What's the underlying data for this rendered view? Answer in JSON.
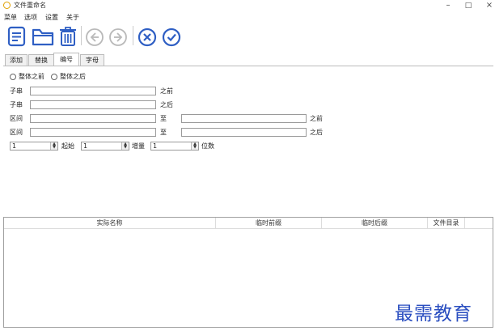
{
  "window": {
    "title": "文件重命名",
    "minimize": "–",
    "maximize": "□",
    "close": "×"
  },
  "menu": [
    "菜单",
    "选项",
    "设置",
    "关于"
  ],
  "toolbar": {
    "icons": [
      "document-icon",
      "folder-icon",
      "trash-icon",
      "undo-icon",
      "redo-icon",
      "cancel-icon",
      "confirm-icon"
    ],
    "accent": "#2f5fc4"
  },
  "tabs": [
    {
      "label": "添加"
    },
    {
      "label": "替换"
    },
    {
      "label": "编号"
    },
    {
      "label": "字母"
    }
  ],
  "numbering": {
    "radio_before": "整体之前",
    "radio_after": "整体之后",
    "row1": {
      "label": "子串",
      "suffix": "之前",
      "value": ""
    },
    "row2": {
      "label": "子串",
      "suffix": "之后",
      "value": ""
    },
    "row3": {
      "label": "区间",
      "mid": "至",
      "suffix": "之前",
      "from": "",
      "to": ""
    },
    "row4": {
      "label": "区间",
      "mid": "至",
      "suffix": "之后",
      "from": "",
      "to": ""
    },
    "start": {
      "value": "1",
      "label": "起始"
    },
    "step": {
      "value": "1",
      "label": "增量"
    },
    "digits": {
      "value": "1",
      "label": "位数"
    }
  },
  "table": {
    "columns": [
      "实际名称",
      "临时前缀",
      "临时后缀",
      "文件目录"
    ]
  },
  "watermark": "最需教育"
}
